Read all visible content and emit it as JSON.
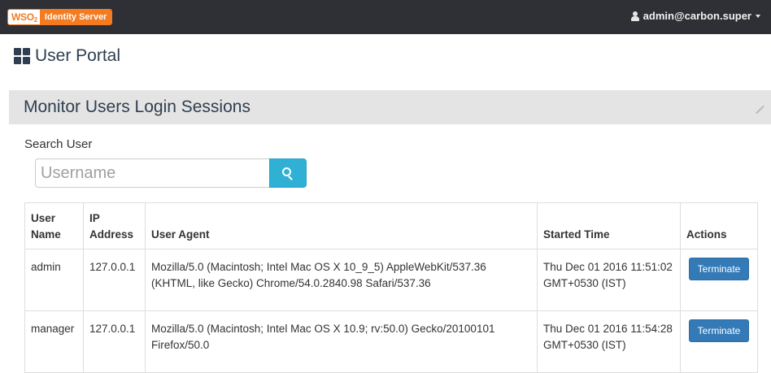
{
  "topbar": {
    "logo_brand": "WSO",
    "logo_brand_sub": "2",
    "logo_product": "Identity Server",
    "user_label": "admin@carbon.super"
  },
  "page": {
    "title": "User Portal"
  },
  "panel": {
    "title": "Monitor Users Login Sessions",
    "search_label": "Search User",
    "search_placeholder": "Username"
  },
  "table": {
    "headers": {
      "user_name": "User Name",
      "ip": "IP Address",
      "user_agent": "User Agent",
      "started": "Started Time",
      "actions": "Actions"
    },
    "rows": [
      {
        "user": "admin",
        "ip": "127.0.0.1",
        "agent": "Mozilla/5.0 (Macintosh; Intel Mac OS X 10_9_5) AppleWebKit/537.36 (KHTML, like Gecko) Chrome/54.0.2840.98 Safari/537.36",
        "started": "Thu Dec 01 2016 11:51:02 GMT+0530 (IST)",
        "action": "Terminate"
      },
      {
        "user": "manager",
        "ip": "127.0.0.1",
        "agent": "Mozilla/5.0 (Macintosh; Intel Mac OS X 10.9; rv:50.0) Gecko/20100101 Firefox/50.0",
        "started": "Thu Dec 01 2016 11:54:28 GMT+0530 (IST)",
        "action": "Terminate"
      }
    ]
  },
  "icons": {
    "user": "user-icon",
    "caret": "caret-down-icon",
    "dashboard": "dashboard-grid-icon",
    "compress": "compress-icon",
    "search": "search-icon"
  },
  "colors": {
    "topbar_bg": "#2e3035",
    "brand_orange": "#f47b20",
    "panel_header_bg": "#e4e4e4",
    "search_button": "#31b0d5",
    "terminate_button": "#337ab7",
    "title_text": "#2f3e50"
  }
}
